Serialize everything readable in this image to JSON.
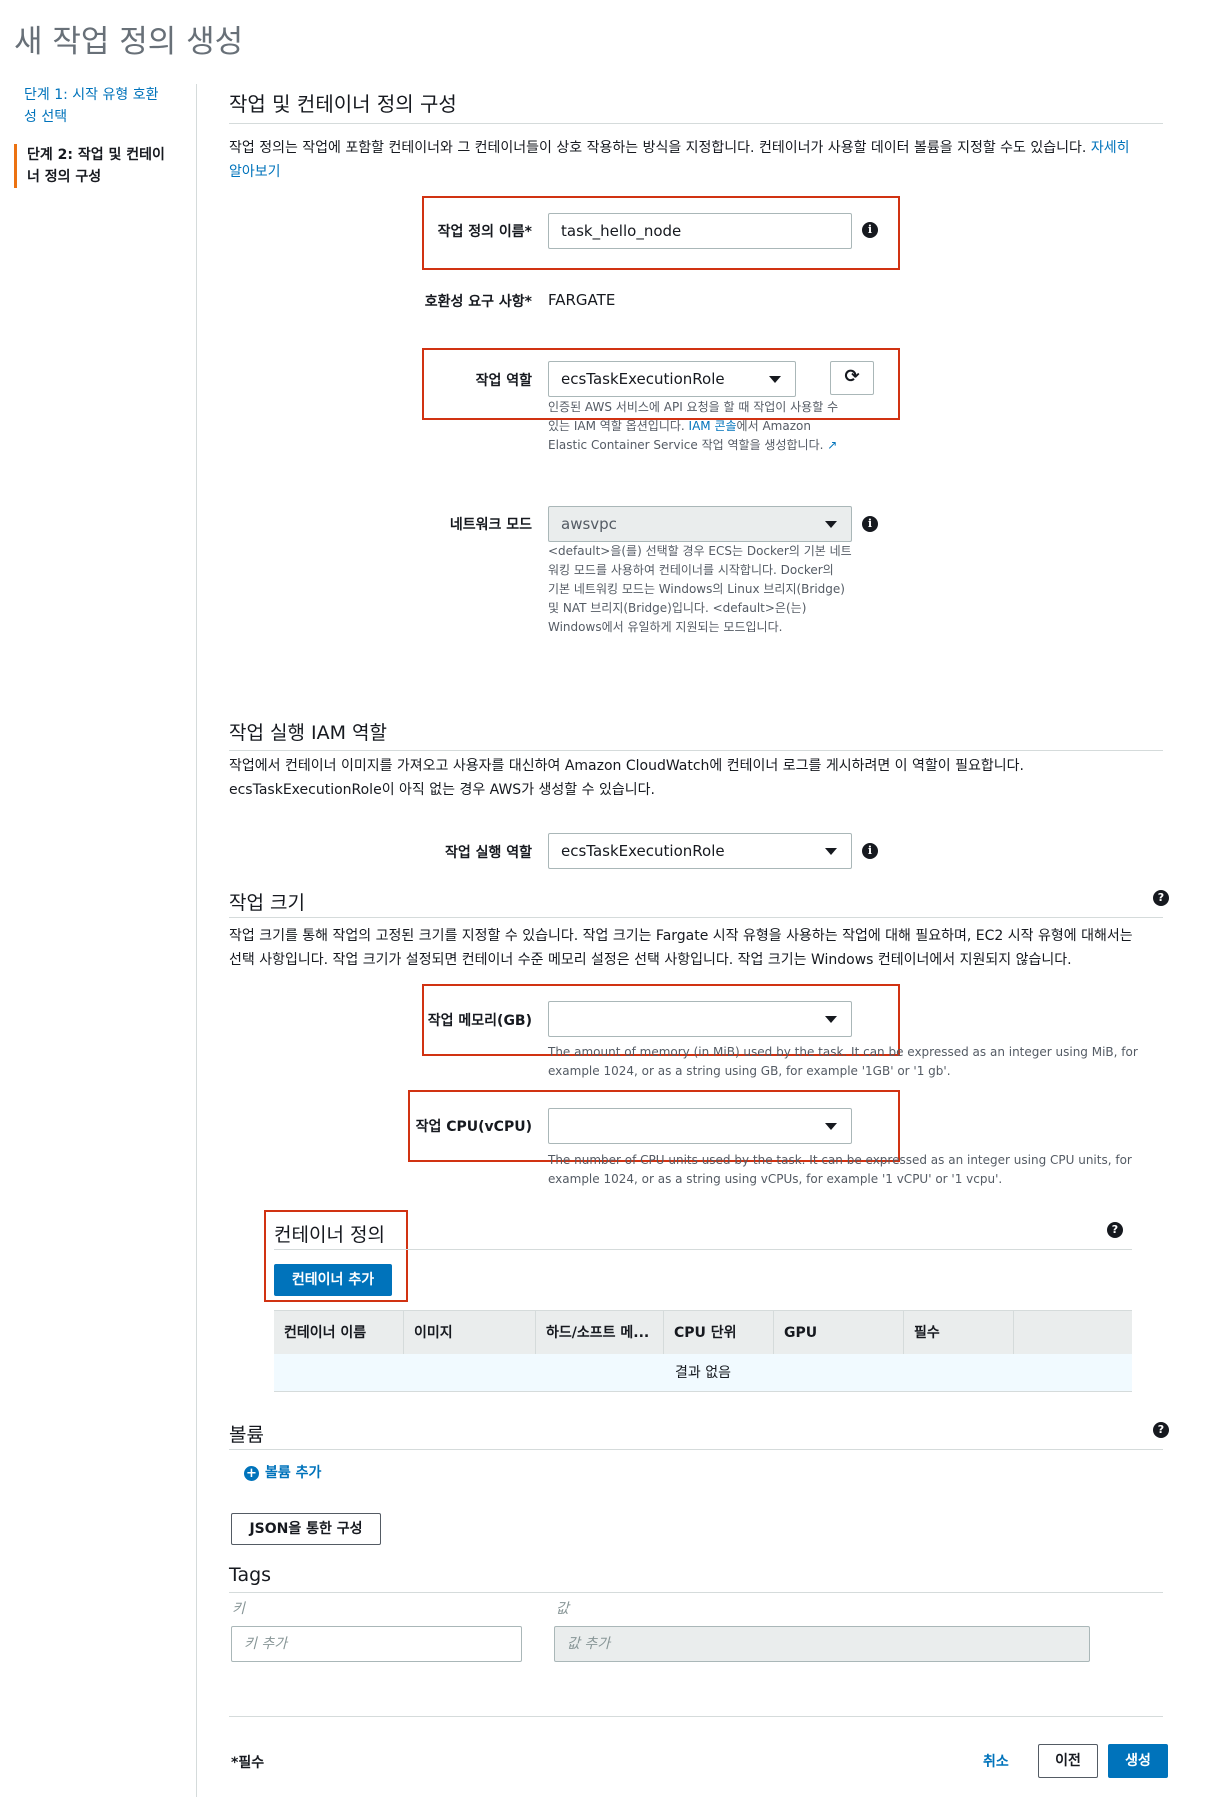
{
  "page": {
    "title": "새 작업 정의 생성"
  },
  "sidebar": {
    "step1": "단계 1: 시작 유형 호환\n성 선택",
    "step1_line1": "단계 1: 시작 유형 호환",
    "step1_line2": "성 선택",
    "step2_line1": "단계 2: 작업 및 컨테이",
    "step2_line2": "너 정의 구성"
  },
  "main": {
    "section_title": "작업 및 컨테이너 정의 구성",
    "intro": "작업 정의는 작업에 포함할 컨테이너와 그 컨테이너들이 상호 작용하는 방식을 지정합니다. 컨테이너가 사용할 데이터 볼륨을 지정할 수도 있습니다.",
    "learn_more_1": "자세히",
    "learn_more_2": "알아보기"
  },
  "form": {
    "name_label": "작업 정의 이름*",
    "name_value": "task_hello_node",
    "compat_label": "호환성 요구 사항*",
    "compat_value": "FARGATE",
    "role_label": "작업 역할",
    "role_value": "ecsTaskExecutionRole",
    "role_hint_1": "인증된 AWS 서비스에 API 요청을 할 때 작업이 사용할 수",
    "role_hint_2a": "있는 IAM 역할 옵션입니다. ",
    "role_hint_link": "IAM 콘솔",
    "role_hint_2b": "에서 Amazon",
    "role_hint_3": "Elastic Container Service 작업 역할을 생성합니다.",
    "network_label": "네트워크 모드",
    "network_value": "awsvpc",
    "network_hint_1": "<default>을(를) 선택할 경우 ECS는 Docker의 기본 네트",
    "network_hint_2": "워킹 모드를 사용하여 컨테이너를 시작합니다. Docker의",
    "network_hint_3": "기본 네트워킹 모드는 Windows의 Linux 브리지(Bridge)",
    "network_hint_4": "및 NAT 브리지(Bridge)입니다. <default>은(는)",
    "network_hint_5": "Windows에서 유일하게 지원되는 모드입니다."
  },
  "iam": {
    "title": "작업 실행 IAM 역할",
    "desc_1": "작업에서 컨테이너 이미지를 가져오고 사용자를 대신하여 Amazon CloudWatch에 컨테이너 로그를 게시하려면 이 역할이 필요합니다.",
    "desc_2": "ecsTaskExecutionRole이 아직 없는 경우 AWS가 생성할 수 있습니다.",
    "exec_label": "작업 실행 역할",
    "exec_value": "ecsTaskExecutionRole"
  },
  "size": {
    "title": "작업 크기",
    "desc_1": "작업 크기를 통해 작업의 고정된 크기를 지정할 수 있습니다. 작업 크기는 Fargate 시작 유형을 사용하는 작업에 대해 필요하며, EC2 시작 유형에 대해서는",
    "desc_2": "선택 사항입니다. 작업 크기가 설정되면 컨테이너 수준 메모리 설정은 선택 사항입니다. 작업 크기는 Windows 컨테이너에서 지원되지 않습니다.",
    "memory_label": "작업 메모리(GB)",
    "memory_hint_1": "The amount of memory (in MiB) used by the task. It can be expressed as an integer using MiB, for",
    "memory_hint_2": "example 1024, or as a string using GB, for example '1GB' or '1 gb'.",
    "cpu_label": "작업 CPU(vCPU)",
    "cpu_hint_1": "The number of CPU units used by the task. It can be expressed as an integer using CPU units, for",
    "cpu_hint_2": "example 1024, or as a string using vCPUs, for example '1 vCPU' or '1 vcpu'."
  },
  "containers": {
    "title": "컨테이너 정의",
    "add_button": "컨테이너 추가",
    "columns": [
      "컨테이너 이름",
      "이미지",
      "하드/소프트 메...",
      "CPU 단위",
      "GPU",
      "필수"
    ],
    "empty": "결과 없음"
  },
  "volumes": {
    "title": "볼륨",
    "add_link": "볼륨 추가"
  },
  "json_button": "JSON을 통한 구성",
  "tags": {
    "title": "Tags",
    "key_label": "키",
    "value_label": "값",
    "key_placeholder": "키 추가",
    "value_placeholder": "값 추가"
  },
  "footer": {
    "required": "*필수",
    "cancel": "취소",
    "previous": "이전",
    "create": "생성"
  },
  "icons": {
    "info": "info-icon",
    "help": "help-icon",
    "refresh": "refresh-icon",
    "external": "external-link-icon",
    "add": "plus-circle-icon"
  },
  "colors": {
    "accent": "#0073bb",
    "highlight_box": "#d13212",
    "step_marker": "#ec7211"
  }
}
